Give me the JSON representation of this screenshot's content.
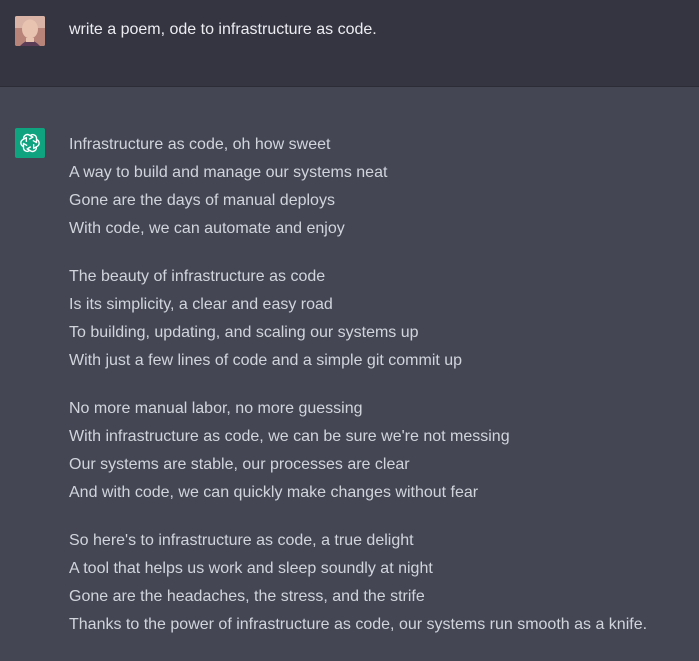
{
  "user": {
    "avatar_icon": "user-avatar-photo",
    "prompt": "write a poem, ode to infrastructure as code."
  },
  "assistant": {
    "avatar_icon": "openai-logo-icon",
    "avatar_color": "#10a37f",
    "stanzas": [
      [
        "Infrastructure as code, oh how sweet",
        "A way to build and manage our systems neat",
        "Gone are the days of manual deploys",
        "With code, we can automate and enjoy"
      ],
      [
        "The beauty of infrastructure as code",
        "Is its simplicity, a clear and easy road",
        "To building, updating, and scaling our systems up",
        "With just a few lines of code and a simple git commit up"
      ],
      [
        "No more manual labor, no more guessing",
        "With infrastructure as code, we can be sure we're not messing",
        "Our systems are stable, our processes are clear",
        "And with code, we can quickly make changes without fear"
      ],
      [
        "So here's to infrastructure as code, a true delight",
        "A tool that helps us work and sleep soundly at night",
        "Gone are the headaches, the stress, and the strife",
        "Thanks to the power of infrastructure as code, our systems run smooth as a knife."
      ]
    ]
  },
  "colors": {
    "user_bg": "#343541",
    "assistant_bg": "#444654",
    "text": "#d1d5db"
  }
}
